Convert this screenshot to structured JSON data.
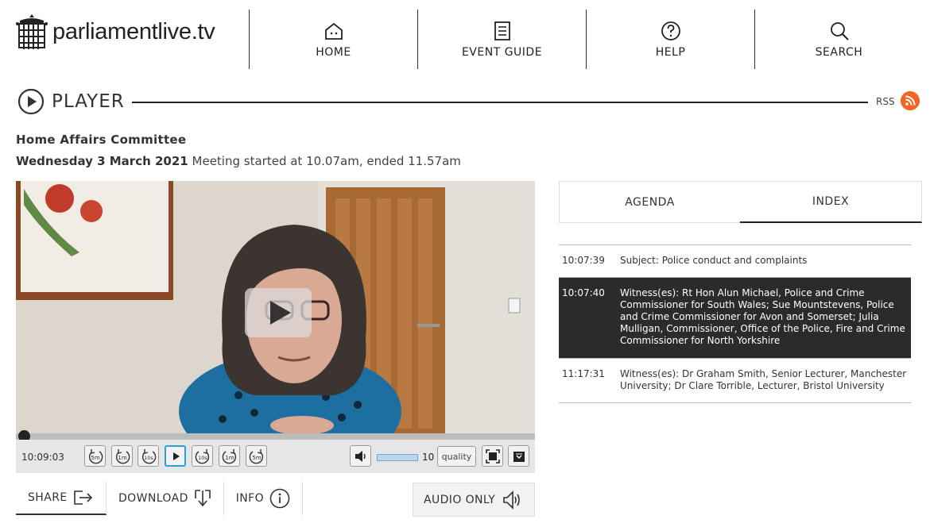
{
  "site": {
    "name": "parliamentlive.tv"
  },
  "nav": [
    {
      "label": "HOME",
      "icon": "home-icon"
    },
    {
      "label": "EVENT GUIDE",
      "icon": "list-icon"
    },
    {
      "label": "HELP",
      "icon": "help-icon"
    },
    {
      "label": "SEARCH",
      "icon": "search-icon"
    }
  ],
  "player": {
    "title": "PLAYER",
    "rss_label": "RSS"
  },
  "meeting": {
    "committee": "Home Affairs Committee",
    "date": "Wednesday 3 March 2021",
    "details": "Meeting started at 10.07am, ended 11.57am"
  },
  "controls": {
    "current_time": "10:09:03",
    "volume": "10",
    "quality_label": "quality",
    "skip_buttons": [
      "5m",
      "1m",
      "10s",
      "10s",
      "1m",
      "5m"
    ]
  },
  "actions": {
    "share": "SHARE",
    "download": "DOWNLOAD",
    "info": "INFO",
    "audio_only": "AUDIO ONLY"
  },
  "tabs": {
    "agenda": "AGENDA",
    "index": "INDEX"
  },
  "index_items": [
    {
      "time": "10:07:39",
      "text": "Subject: Police conduct and complaints"
    },
    {
      "time": "10:07:40",
      "text": "Witness(es): Rt Hon Alun Michael, Police and Crime Commissioner for South Wales; Sue Mountstevens, Police and Crime Commissioner for Avon and Somerset; Julia Mulligan, Commissioner, Office of the Police, Fire and Crime Commissioner for North Yorkshire"
    },
    {
      "time": "11:17:31",
      "text": "Witness(es): Dr Graham Smith, Senior Lecturer, Manchester University; Dr Clare Torrible, Lecturer, Bristol University"
    }
  ],
  "colors": {
    "rss": "#f26522",
    "active_row": "#2b2b2b",
    "accent": "#2a9fd6"
  }
}
